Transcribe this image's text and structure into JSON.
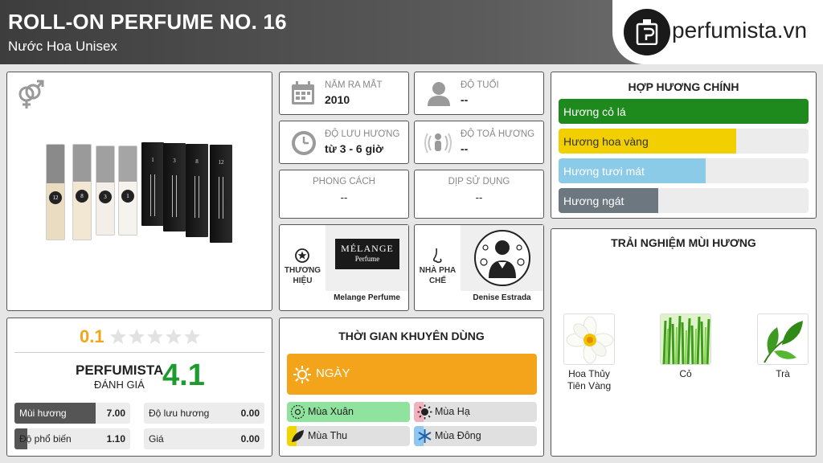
{
  "header": {
    "title": "ROLL-ON PERFUME NO. 16",
    "subtitle": "Nước Hoa Unisex",
    "logo_text": "perfumista.vn"
  },
  "info": {
    "year": {
      "label": "NĂM RA MẮT",
      "value": "2010"
    },
    "age": {
      "label": "ĐỘ TUỔI",
      "value": "--"
    },
    "longevity": {
      "label": "ĐỘ LƯU HƯƠNG",
      "value": "từ 3 - 6 giờ"
    },
    "sillage": {
      "label": "ĐỘ TOẢ HƯƠNG",
      "value": "--"
    },
    "style": {
      "label": "PHONG CÁCH",
      "value": "--"
    },
    "occasion": {
      "label": "DỊP SỬ DỤNG",
      "value": "--"
    },
    "brand": {
      "label": "THƯƠNG HIỆU",
      "name": "Melange Perfume",
      "logo_line1": "MÉLANGE",
      "logo_line2": "Perfume"
    },
    "perfumer": {
      "label": "NHÀ PHA CHẾ",
      "name": "Denise Estrada"
    }
  },
  "bottles": [
    {
      "cap": "#8a8a8a",
      "body": "#e9dcc0",
      "num": "12"
    },
    {
      "cap": "#9a9a9a",
      "body": "#f1e7d3",
      "num": "8"
    },
    {
      "cap": "#a0a0a0",
      "body": "#f3efe8",
      "num": "3"
    },
    {
      "cap": "#a5a5a5",
      "body": "#f6f3ee",
      "num": "1"
    }
  ],
  "boxes": [
    "1",
    "3",
    "8",
    "12"
  ],
  "accords": {
    "title": "HỢP HƯƠNG CHÍNH",
    "items": [
      {
        "label": "Hương cỏ lá",
        "level": 1.0,
        "color": "#1e8a1e"
      },
      {
        "label": "Hương hoa vàng",
        "level": 0.71,
        "color": "#f2cf00"
      },
      {
        "label": "Hương tươi mát",
        "level": 0.59,
        "color": "#8ccbe8"
      },
      {
        "label": "Hương ngát",
        "level": 0.4,
        "color": "#6c7780"
      }
    ]
  },
  "rating": {
    "user_score": "0.1",
    "stars": 5,
    "brand_name": "PERFUMISTA",
    "brand_caption": "ĐÁNH GIÁ",
    "score": "4.1",
    "stats": [
      {
        "label": "Mùi hương",
        "value": "7.00",
        "fraction": 0.7
      },
      {
        "label": "Độ lưu hương",
        "value": "0.00",
        "fraction": 0.0
      },
      {
        "label": "Độ phổ biến",
        "value": "1.10",
        "fraction": 0.11
      },
      {
        "label": "Giá",
        "value": "0.00",
        "fraction": 0.0
      }
    ]
  },
  "time": {
    "title": "THỜI GIAN KHUYÊN DÙNG",
    "day_label": "NGÀY",
    "day_color": "#f3a41b",
    "seasons": [
      {
        "label": "Mùa Xuân",
        "color": "#8fe39e",
        "fraction": 1.0
      },
      {
        "label": "Mùa Hạ",
        "color": "#f2b1bd",
        "fraction": 0.08
      },
      {
        "label": "Mùa Thu",
        "color": "#f2d400",
        "fraction": 0.08
      },
      {
        "label": "Mùa Đông",
        "color": "#90c7f0",
        "fraction": 0.08
      }
    ]
  },
  "notes": {
    "title": "TRẢI NGHIỆM MÙI HƯƠNG",
    "items": [
      {
        "label": "Hoa Thủy Tiên Vàng"
      },
      {
        "label": "Cỏ"
      },
      {
        "label": "Trà"
      }
    ]
  }
}
